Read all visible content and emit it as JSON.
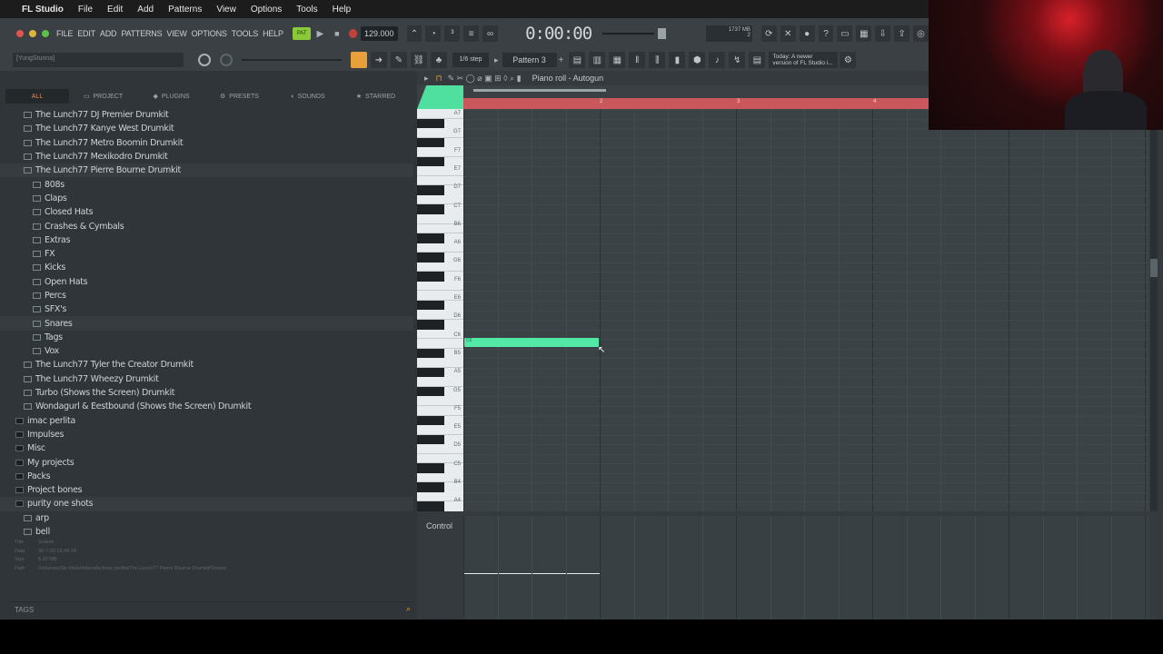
{
  "mac_menu": {
    "app": "FL Studio",
    "items": [
      "File",
      "Edit",
      "Add",
      "Patterns",
      "View",
      "Options",
      "Tools",
      "Help"
    ]
  },
  "toolbar": {
    "fl_menu": [
      "FILE",
      "EDIT",
      "ADD",
      "PATTERNS",
      "VIEW",
      "OPTIONS",
      "TOOLS",
      "HELP"
    ],
    "tempo": "129.000",
    "timecode": "0:00:00",
    "step": "1/6 step",
    "pattern": "Pattern 3",
    "hint_user": "[YungStunna]",
    "news_line1": "Today: A newer",
    "news_line2": "version of FL Studio i...",
    "memory": "1737 MB",
    "cpu_label": "6",
    "voices": "2"
  },
  "browser": {
    "tabs": [
      "ALL",
      "PROJECT",
      "PLUGINS",
      "PRESETS",
      "SOUNDS",
      "STARRED"
    ],
    "tree": [
      {
        "label": "The Lunch77 DJ Premier Drumkit",
        "level": 1
      },
      {
        "label": "The Lunch77 Kanye West Drumkit",
        "level": 1
      },
      {
        "label": "The Lunch77 Metro Boomin Drumkit",
        "level": 1
      },
      {
        "label": "The Lunch77 Mexikodro Drumkit",
        "level": 1
      },
      {
        "label": "The Lunch77 Pierre Bourne Drumkit",
        "level": 1,
        "selected": true
      },
      {
        "label": "808s",
        "level": 2
      },
      {
        "label": "Claps",
        "level": 2
      },
      {
        "label": "Closed Hats",
        "level": 2
      },
      {
        "label": "Crashes & Cymbals",
        "level": 2
      },
      {
        "label": "Extras",
        "level": 2
      },
      {
        "label": "FX",
        "level": 2
      },
      {
        "label": "Kicks",
        "level": 2
      },
      {
        "label": "Open Hats",
        "level": 2
      },
      {
        "label": "Percs",
        "level": 2
      },
      {
        "label": "SFX's",
        "level": 2
      },
      {
        "label": "Snares",
        "level": 2,
        "selected": true
      },
      {
        "label": "Tags",
        "level": 2
      },
      {
        "label": "Vox",
        "level": 2
      },
      {
        "label": "The Lunch77 Tyler the Creator Drumkit",
        "level": 1
      },
      {
        "label": "The Lunch77 Wheezy Drumkit",
        "level": 1
      },
      {
        "label": "Turbo (Shows the Screen) Drumkit",
        "level": 1
      },
      {
        "label": "Wondagurl & Eestbound (Shows the Screen) Drumkit",
        "level": 1
      },
      {
        "label": "imac perlita",
        "level": 0
      },
      {
        "label": "Impulses",
        "level": 0
      },
      {
        "label": "Misc",
        "level": 0
      },
      {
        "label": "My projects",
        "level": 0
      },
      {
        "label": "Packs",
        "level": 0
      },
      {
        "label": "Project bones",
        "level": 0
      },
      {
        "label": "purity one shots",
        "level": 0,
        "selected": true
      },
      {
        "label": "arp",
        "level": 1
      },
      {
        "label": "bell",
        "level": 1
      }
    ],
    "info": {
      "title_key": "Title",
      "title": "Snares",
      "date_key": "Date",
      "date": "30-7-20 18:48:18",
      "size_key": "Size",
      "size": "5.22 MB",
      "path_key": "Path",
      "path": "/Volumes/Sin título/oldstudio/imac perlita/The Lunch77 Pierre Bourne Drumkit/Snares"
    },
    "tags_label": "TAGS"
  },
  "piano_roll": {
    "title": "Piano roll - Autogun",
    "bar_numbers": [
      "2",
      "3",
      "4"
    ],
    "key_labels": [
      "A7",
      "G7",
      "F7",
      "E7",
      "D7",
      "C7",
      "B6",
      "A6",
      "G6",
      "F6",
      "E6",
      "D6",
      "C6",
      "B5",
      "A5",
      "G5",
      "F5",
      "E5",
      "D5",
      "C5",
      "B4",
      "A4"
    ],
    "note_label": "C6",
    "control_label": "Control"
  },
  "colors": {
    "accent": "#54e8a6",
    "ruler": "#c9575b",
    "bg": "#343a3e"
  }
}
